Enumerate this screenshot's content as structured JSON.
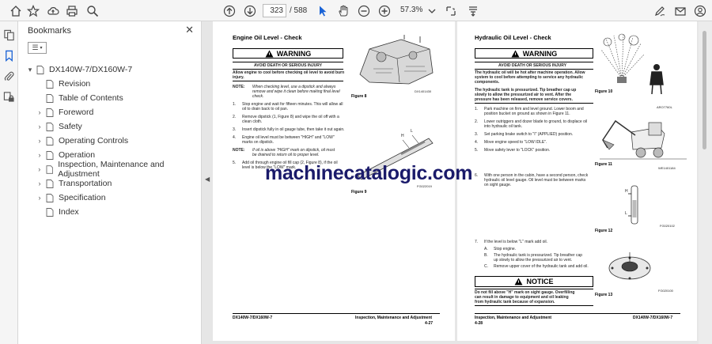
{
  "toolbar": {
    "page_current": "323",
    "page_total": "/ 588",
    "zoom": "57.3%"
  },
  "bookmarks": {
    "title": "Bookmarks",
    "items": [
      {
        "label": "DX140W-7/DX160W-7",
        "level": 0,
        "toggle": "▾"
      },
      {
        "label": "Revision",
        "level": 1,
        "toggle": ""
      },
      {
        "label": "Table of Contents",
        "level": 1,
        "toggle": ""
      },
      {
        "label": "Foreword",
        "level": 1,
        "toggle": "›"
      },
      {
        "label": "Safety",
        "level": 1,
        "toggle": "›"
      },
      {
        "label": "Operating Controls",
        "level": 1,
        "toggle": "›"
      },
      {
        "label": "Operation",
        "level": 1,
        "toggle": "›"
      },
      {
        "label": "Inspection, Maintenance and Adjustment",
        "level": 1,
        "toggle": "›"
      },
      {
        "label": "Transportation",
        "level": 1,
        "toggle": "›"
      },
      {
        "label": "Specification",
        "level": 1,
        "toggle": "›"
      },
      {
        "label": "Index",
        "level": 1,
        "toggle": ""
      }
    ]
  },
  "watermark": "machinecatalogic.com",
  "page_left": {
    "heading": "Engine Oil Level - Check",
    "warning": "WARNING",
    "avoid": "AVOID DEATH OR SERIOUS INJURY",
    "intro": "Allow engine to cool before checking oil level to avoid burn injury.",
    "note1_label": "NOTE:",
    "note1_a": "When checking level, use a dipstick and always",
    "note1_b": "remove and wipe it clean before making final level",
    "note1_c": "check.",
    "s1_n": "1.",
    "s1_a": "Stop engine and wait for fifteen minutes. This will allow all",
    "s1_b": "oil to drain back to oil pan.",
    "s2_n": "2.",
    "s2_a": "Remove dipstick (1, Figure 8) and wipe the oil off with a",
    "s2_b": "clean cloth.",
    "s3_n": "3.",
    "s3_a": "Insert dipstick fully in oil gauge tube, then take it out again.",
    "s4_n": "4.",
    "s4_a": "Engine oil level must be between \"HIGH\" and \"LOW\"",
    "s4_b": "marks on dipstick.",
    "note2_label": "NOTE:",
    "note2_a": "If oil is above \"HIGH\" mark on dipstick, oil must",
    "note2_b": "be drained to return oil to proper level.",
    "s5_n": "5.",
    "s5_a": "Add oil through engine oil fill cap (2, Figure 8), if the oil",
    "s5_b": "level is below the \"LOW\" mark.",
    "fig8_code": "DX1401430",
    "fig8_cap": "Figure 8",
    "fig9_code": "FG022019",
    "fig9_cap": "Figure 9",
    "fig9_h": "H",
    "fig9_l": "L",
    "footer_left": "DX140W-7/DX160W-7",
    "footer_right": "Inspection, Maintenance and Adjustment",
    "footer_page": "4-27"
  },
  "page_right": {
    "heading": "Hydraulic Oil Level - Check",
    "warning": "WARNING",
    "avoid": "AVOID DEATH OR SERIOUS INJURY",
    "intro_a": "The hydraulic oil will be hot after machine operation. Allow",
    "intro_b": "system to cool before attempting to service any hydraulic",
    "intro_c": "components.",
    "intro2_a": "The hydraulic tank is pressurized. Tip breather cap up",
    "intro2_b": "slowly to allow the pressurized air to vent. After the",
    "intro2_c": "pressure has been released, remove service covers.",
    "s1_n": "1.",
    "s1_a": "Park machine on firm and level ground. Lower boom and",
    "s1_b": "position bucket on ground as shown in Figure 11.",
    "s2_n": "2.",
    "s2_a": "Lower outriggers and dozer blade to ground, to displace oil",
    "s2_b": "into hydraulic oil tank.",
    "s3_n": "3.",
    "s3_a": "Set parking brake switch to \"I\" (APPLIED) position.",
    "s4_n": "4.",
    "s4_a": "Move engine speed to \"LOW IDLE\".",
    "s5_n": "5.",
    "s5_a": "Move safety lever to \"LOCK\" position.",
    "s6_n": "6.",
    "s6_a": "With one person in the cabin, have a second person, check",
    "s6_b": "hydraulic oil level gauge. Oil level must be between marks",
    "s6_c": "on sight gauge.",
    "s7_n": "7.",
    "s7_a": "If the level is below \"L\" mark add oil.",
    "sA_n": "A.",
    "sA_a": "Stop engine.",
    "sB_n": "B.",
    "sB_a": "The hydraulic tank is pressurized. Tip breather cap",
    "sB_b": "up slowly to allow the pressurized air to vent.",
    "sC_n": "C.",
    "sC_a": "Remove upper cover of the hydraulic tank and add oil.",
    "notice": "NOTICE",
    "notice_a": "Do not fill above \"H\" mark on sight gauge. Overfilling",
    "notice_b": "can result in damage to equipment and oil leaking",
    "notice_c": "from hydraulic tank because of expansion.",
    "fig10_code": "ARO7760L",
    "fig10_cap": "Figure 10",
    "fig11_code": "WE1401184",
    "fig11_cap": "Figure 11",
    "fig12_code": "FG020102",
    "fig12_cap": "Figure 12",
    "fig12_h": "H",
    "fig12_l": "L",
    "fig13_code": "FG020100",
    "fig13_cap": "Figure 13",
    "footer_left": "Inspection, Maintenance and Adjustment",
    "footer_page": "4-28",
    "footer_right": "DX140W-7/DX160W-7"
  }
}
